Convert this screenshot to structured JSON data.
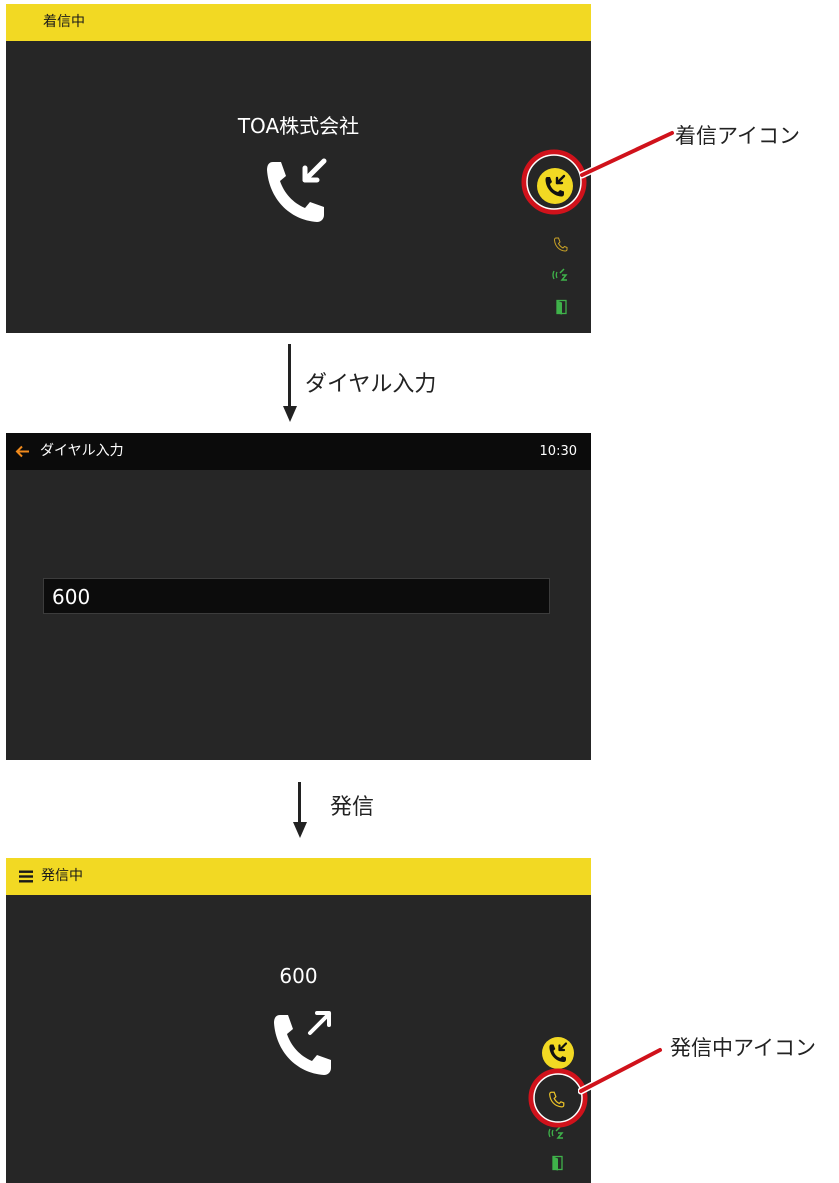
{
  "incoming": {
    "status_label": "着信中",
    "caller_name": "TOA株式会社",
    "callout_label": "着信アイコン"
  },
  "step1": {
    "label": "ダイヤル入力"
  },
  "dial": {
    "header_title": "ダイヤル入力",
    "clock": "10:30",
    "number_value": "600"
  },
  "step2": {
    "label": "発信"
  },
  "outgoing": {
    "status_label": "発信中",
    "number": "600",
    "callout_label": "発信中アイコン"
  },
  "colors": {
    "status_bar": "#f2d923",
    "screen_bg": "#262626",
    "header_bg": "#0b0b0b",
    "callout_red": "#d0121b",
    "icon_green": "#3fb24a",
    "icon_gold": "#c9a227",
    "back_arrow": "#f08a1c"
  }
}
